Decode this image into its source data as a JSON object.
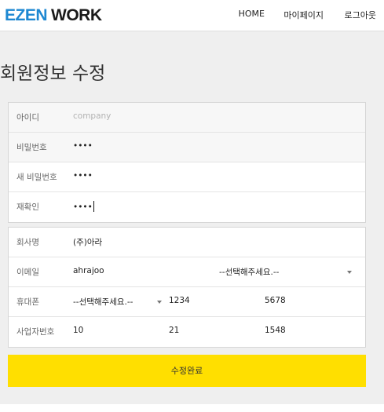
{
  "header": {
    "logo_part1": "EZEN",
    "logo_part2": "WORK",
    "nav": {
      "home": "HOME",
      "mypage": "마이페이지",
      "logout": "로그아웃"
    }
  },
  "page_title": "회원정보 수정",
  "account": {
    "id_label": "아이디",
    "id_placeholder": "company",
    "password_label": "비밀번호",
    "password_value": "••••",
    "new_password_label": "새 비밀번호",
    "new_password_value": "••••",
    "confirm_label": "재확인",
    "confirm_value": "••••"
  },
  "company": {
    "name_label": "회사명",
    "name_value": "(주)아라",
    "email_label": "이메일",
    "email_local": "ahrajoo",
    "email_domain_select": "--선택해주세요.--",
    "phone_label": "휴대폰",
    "phone_prefix_select": "--선택해주세요.--",
    "phone_middle": "1234",
    "phone_last": "5678",
    "bizno_label": "사업자번호",
    "bizno_1": "10",
    "bizno_2": "21",
    "bizno_3": "1548"
  },
  "submit_label": "수정완료",
  "colors": {
    "logo_accent": "#1e88d2",
    "submit_bg": "#ffdf00",
    "page_bg": "#efefef"
  }
}
